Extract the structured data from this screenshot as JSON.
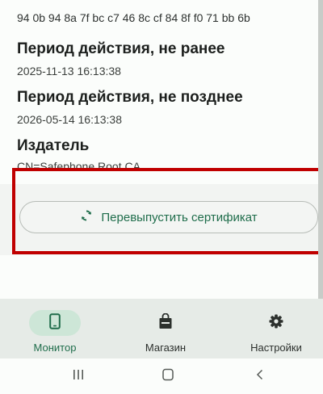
{
  "certificate": {
    "fingerprint_tail": "94 0b 94 8a 7f bc c7 46 8c cf 84 8f f0 71 bb 6b",
    "valid_from_label": "Период действия, не ранее",
    "valid_from_value": "2025-11-13 16:13:38",
    "valid_to_label": "Период действия, не позднее",
    "valid_to_value": "2026-05-14 16:13:38",
    "issuer_label": "Издатель",
    "issuer_value": "CN=Safephone Root CA"
  },
  "reissue_button": {
    "label": "Перевыпустить сертификат",
    "icon": "refresh-icon"
  },
  "bottom_nav": {
    "items": [
      {
        "label": "Монитор",
        "icon": "phone-icon",
        "active": true
      },
      {
        "label": "Магазин",
        "icon": "shopping-bag-icon",
        "active": false
      },
      {
        "label": "Настройки",
        "icon": "gear-icon",
        "active": false
      }
    ]
  },
  "system_nav": {
    "buttons": [
      "recent-apps",
      "home",
      "back"
    ]
  },
  "colors": {
    "accent": "#1f6d4b",
    "active_pill": "#cde6d7",
    "nav_bg": "#e6ebe7",
    "highlight": "#c00000"
  }
}
